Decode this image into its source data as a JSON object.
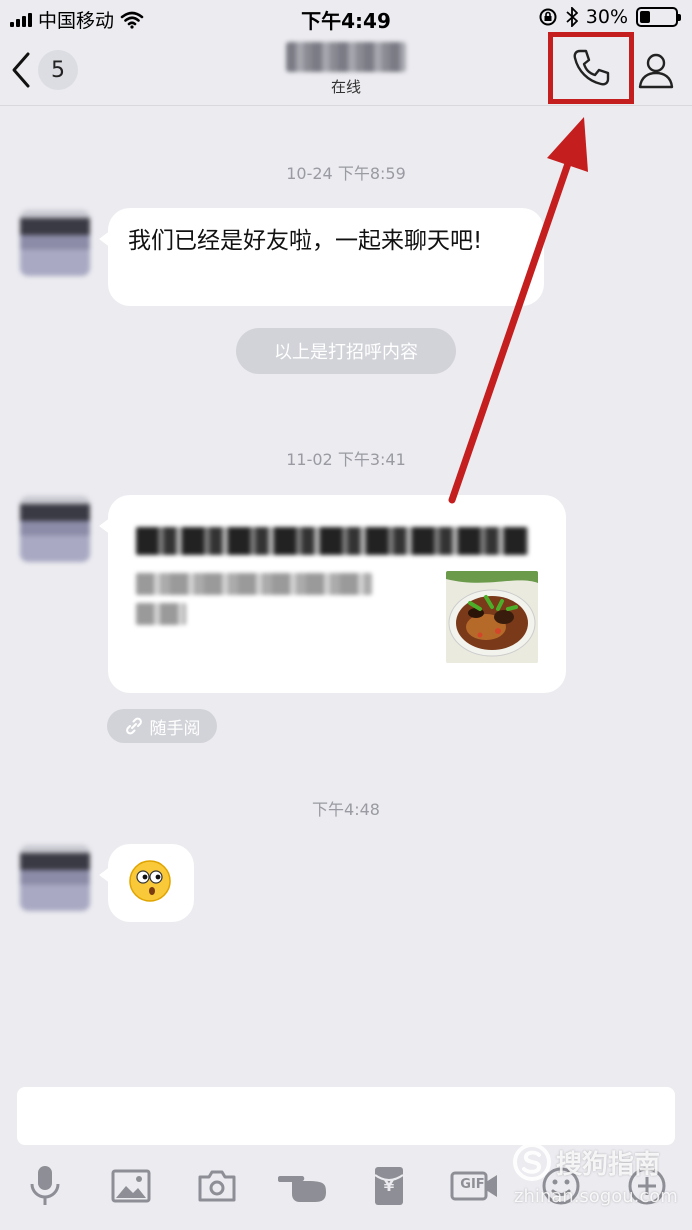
{
  "status_bar": {
    "carrier": "中国移动",
    "time": "下午4:49",
    "battery_text": "30%",
    "battery_level": 0.3
  },
  "nav": {
    "unread_count": "5",
    "contact_status": "在线"
  },
  "messages": {
    "ts1": "10-24 下午8:59",
    "msg1": "我们已经是好友啦，一起来聊天吧!",
    "system_notice": "以上是打招呼内容",
    "ts2": "11-02 下午3:41",
    "ts3": "下午4:48"
  },
  "read_tag": "随手阅",
  "toolbar": {
    "icons": [
      "mic-icon",
      "image-icon",
      "camera-icon",
      "poke-icon",
      "red-packet-icon",
      "gif-icon",
      "emoji-icon",
      "plus-icon"
    ],
    "gif_label": "GIF",
    "red_packet_symbol": "¥"
  },
  "watermark": {
    "brand": "搜狗指南",
    "url": "zhinan.sogou.com"
  },
  "colors": {
    "highlight": "#c41e1e",
    "background": "#ebebf0",
    "pill": "#d2d3d8"
  }
}
